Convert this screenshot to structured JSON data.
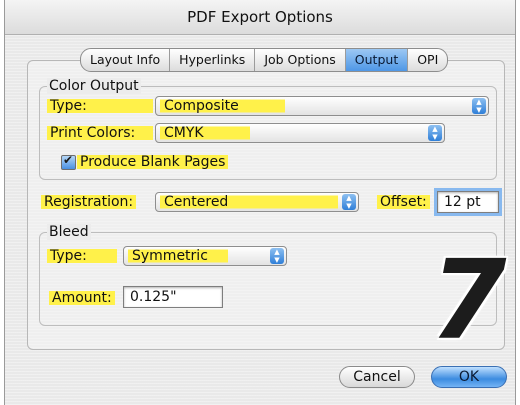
{
  "dialog": {
    "title": "PDF Export Options"
  },
  "tabs": [
    {
      "label": "Layout Info",
      "active": false
    },
    {
      "label": "Hyperlinks",
      "active": false
    },
    {
      "label": "Job Options",
      "active": false
    },
    {
      "label": "Output",
      "active": true
    },
    {
      "label": "OPI",
      "active": false
    }
  ],
  "color_output": {
    "legend": "Color Output",
    "type_label": "Type:",
    "type_value": "Composite",
    "print_colors_label": "Print Colors:",
    "print_colors_value": "CMYK",
    "blank_pages_label": "Produce Blank Pages",
    "blank_pages_checked": true
  },
  "registration": {
    "label": "Registration:",
    "value": "Centered",
    "offset_label": "Offset:",
    "offset_value": "12 pt"
  },
  "bleed": {
    "legend": "Bleed",
    "type_label": "Type:",
    "type_value": "Symmetric",
    "amount_label": "Amount:",
    "amount_value": "0.125\""
  },
  "overlay_number": "7",
  "buttons": {
    "cancel": "Cancel",
    "ok": "OK"
  },
  "colors": {
    "highlight": "#fff14a",
    "accent": "#4e97e6"
  }
}
